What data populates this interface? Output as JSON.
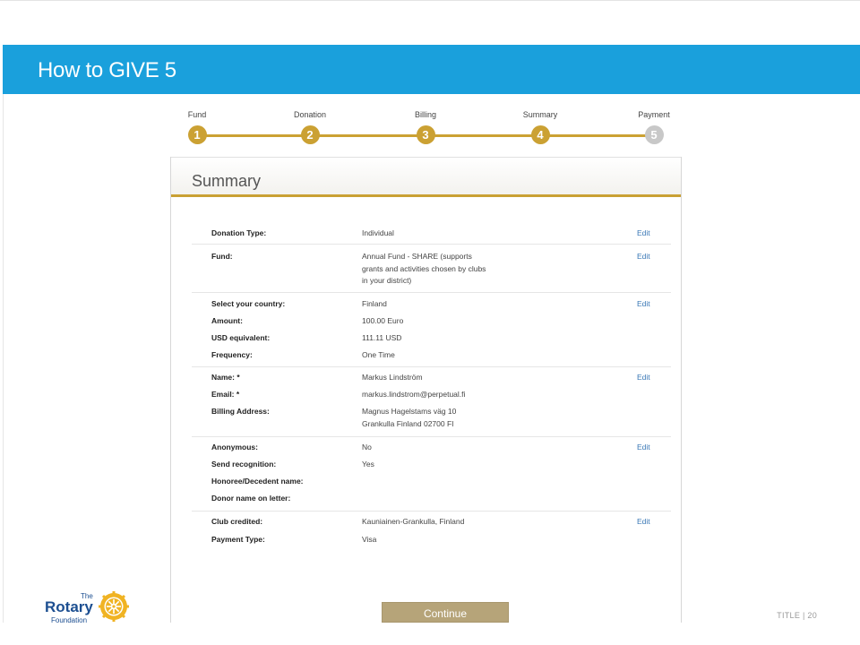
{
  "slide": {
    "title": "How to GIVE 5",
    "footer_label": "TITLE | 20"
  },
  "stepper": {
    "steps": [
      {
        "label": "Fund",
        "number": "1",
        "active": true
      },
      {
        "label": "Donation",
        "number": "2",
        "active": true
      },
      {
        "label": "Billing",
        "number": "3",
        "active": true
      },
      {
        "label": "Summary",
        "number": "4",
        "active": true
      },
      {
        "label": "Payment",
        "number": "5",
        "active": false
      }
    ]
  },
  "summary": {
    "title": "Summary",
    "edit_label": "Edit",
    "groups": [
      {
        "rows": [
          {
            "key": "Donation Type:",
            "value": "Individual"
          }
        ]
      },
      {
        "rows": [
          {
            "key": "Fund:",
            "value": "Annual Fund - SHARE (supports grants and activities chosen by clubs in your district)"
          }
        ]
      },
      {
        "rows": [
          {
            "key": "Select your country:",
            "value": "Finland"
          },
          {
            "key": "Amount:",
            "value": "100.00 Euro"
          },
          {
            "key": "USD equivalent:",
            "value": "111.11 USD"
          },
          {
            "key": "Frequency:",
            "value": "One Time"
          }
        ]
      },
      {
        "rows": [
          {
            "key": "Name: *",
            "value": "Markus Lindström"
          },
          {
            "key": "Email: *",
            "value": "markus.lindstrom@perpetual.fi"
          },
          {
            "key": "Billing Address:",
            "value": "Magnus Hagelstams väg 10 Grankulla Finland 02700 FI"
          }
        ]
      },
      {
        "rows": [
          {
            "key": "Anonymous:",
            "value": "No"
          },
          {
            "key": "Send recognition:",
            "value": "Yes"
          },
          {
            "key": "Honoree/Decedent name:",
            "value": ""
          },
          {
            "key": "Donor name on letter:",
            "value": ""
          }
        ]
      },
      {
        "rows": [
          {
            "key": "Club credited:",
            "value": "Kauniainen-Grankulla, Finland"
          },
          {
            "key": "Payment Type:",
            "value": "Visa"
          }
        ]
      }
    ],
    "continue_label": "Continue"
  },
  "logo": {
    "the": "The",
    "name": "Rotary",
    "sub": "Foundation"
  },
  "colors": {
    "header": "#1aa0dc",
    "gold": "#cba133",
    "button": "#b6a479",
    "link": "#3a78b6"
  }
}
